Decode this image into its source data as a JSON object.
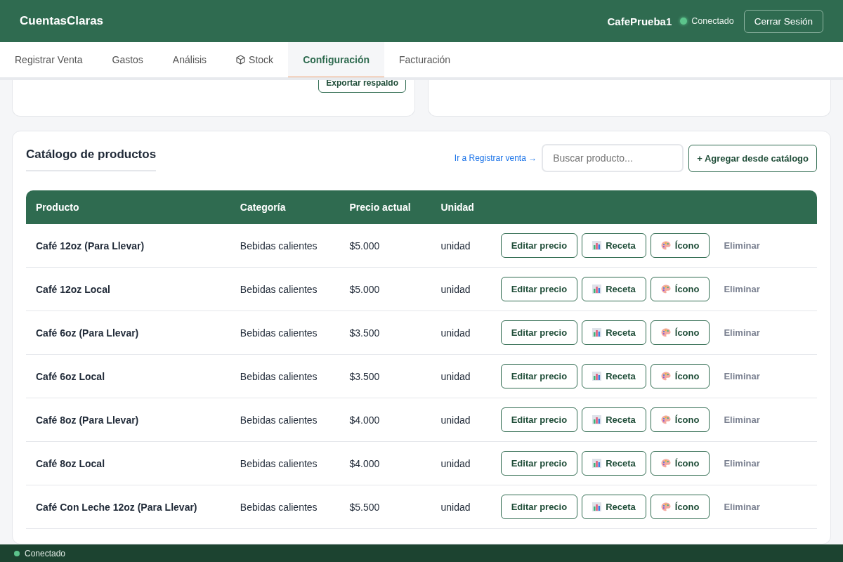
{
  "header": {
    "brand": "CuentasClaras",
    "user": "CafePrueba1",
    "status": "Conectado",
    "online": true,
    "logout": "Cerrar Sesión"
  },
  "tabs": [
    {
      "label": "Registrar Venta",
      "selected": false,
      "kind": "text"
    },
    {
      "label": "Gastos",
      "selected": false,
      "kind": "text"
    },
    {
      "label": "Análisis",
      "selected": false,
      "kind": "text"
    },
    {
      "label": "Stock",
      "selected": false,
      "kind": "stock"
    },
    {
      "label": "Configuración",
      "selected": true,
      "kind": "text"
    },
    {
      "label": "Facturación",
      "selected": false,
      "kind": "text"
    }
  ],
  "backup": {
    "button": "Exportar respaldo"
  },
  "catalog": {
    "title": "Catálogo de productos",
    "link": "Ir a Registrar venta →",
    "search": {
      "placeholder": "Buscar producto..."
    },
    "add_button": "+ Agregar desde catálogo",
    "columns": [
      "Producto",
      "Categoría",
      "Precio actual",
      "Unidad"
    ],
    "rows": [
      {
        "product": "Café 12oz (Para Llevar)",
        "category": "Bebidas calientes",
        "price": "$5.000",
        "unit": "unidad",
        "actions": [
          {
            "kind": "edit",
            "label": "Editar precio"
          },
          {
            "kind": "recipe",
            "label": "Receta"
          },
          {
            "kind": "icon",
            "label": "Ícono"
          },
          {
            "kind": "delete",
            "label": "Eliminar"
          }
        ]
      },
      {
        "product": "Café 12oz Local",
        "category": "Bebidas calientes",
        "price": "$5.000",
        "unit": "unidad",
        "actions": [
          {
            "kind": "edit",
            "label": "Editar precio"
          },
          {
            "kind": "recipe",
            "label": "Receta"
          },
          {
            "kind": "icon",
            "label": "Ícono"
          },
          {
            "kind": "delete",
            "label": "Eliminar"
          }
        ]
      },
      {
        "product": "Café 6oz (Para Llevar)",
        "category": "Bebidas calientes",
        "price": "$3.500",
        "unit": "unidad",
        "actions": [
          {
            "kind": "edit",
            "label": "Editar precio"
          },
          {
            "kind": "recipe",
            "label": "Receta"
          },
          {
            "kind": "icon",
            "label": "Ícono"
          },
          {
            "kind": "delete",
            "label": "Eliminar"
          }
        ]
      },
      {
        "product": "Café 6oz Local",
        "category": "Bebidas calientes",
        "price": "$3.500",
        "unit": "unidad",
        "actions": [
          {
            "kind": "edit",
            "label": "Editar precio"
          },
          {
            "kind": "recipe",
            "label": "Receta"
          },
          {
            "kind": "icon",
            "label": "Ícono"
          },
          {
            "kind": "delete",
            "label": "Eliminar"
          }
        ]
      },
      {
        "product": "Café 8oz (Para Llevar)",
        "category": "Bebidas calientes",
        "price": "$4.000",
        "unit": "unidad",
        "actions": [
          {
            "kind": "edit",
            "label": "Editar precio"
          },
          {
            "kind": "recipe",
            "label": "Receta"
          },
          {
            "kind": "icon",
            "label": "Ícono"
          },
          {
            "kind": "delete",
            "label": "Eliminar"
          }
        ]
      },
      {
        "product": "Café 8oz Local",
        "category": "Bebidas calientes",
        "price": "$4.000",
        "unit": "unidad",
        "actions": [
          {
            "kind": "edit",
            "label": "Editar precio"
          },
          {
            "kind": "recipe",
            "label": "Receta"
          },
          {
            "kind": "icon",
            "label": "Ícono"
          },
          {
            "kind": "delete",
            "label": "Eliminar"
          }
        ]
      },
      {
        "product": "Café Con Leche 12oz (Para Llevar)",
        "category": "Bebidas calientes",
        "price": "$5.500",
        "unit": "unidad",
        "actions": [
          {
            "kind": "edit",
            "label": "Editar precio"
          },
          {
            "kind": "recipe",
            "label": "Receta"
          },
          {
            "kind": "icon",
            "label": "Ícono"
          },
          {
            "kind": "delete",
            "label": "Eliminar"
          }
        ]
      }
    ]
  },
  "status_bar": {
    "status": "Conectado",
    "online": true
  }
}
